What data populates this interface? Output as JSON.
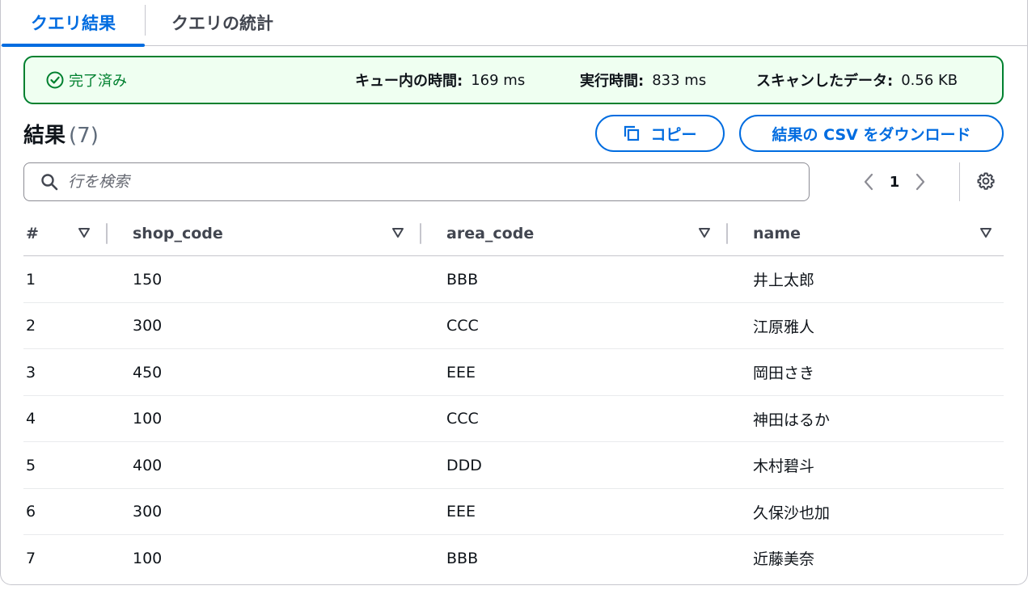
{
  "tabs": [
    {
      "label": "クエリ結果"
    },
    {
      "label": "クエリの統計"
    }
  ],
  "banner": {
    "status": "完了済み",
    "queue_time_label": "キュー内の時間:",
    "queue_time_value": "169 ms",
    "exec_time_label": "実行時間:",
    "exec_time_value": "833 ms",
    "scan_label": "スキャンしたデータ:",
    "scan_value": "0.56 KB"
  },
  "results": {
    "title": "結果",
    "count": "(7)"
  },
  "buttons": {
    "copy": "コピー",
    "download_csv": "結果の CSV をダウンロード"
  },
  "search": {
    "placeholder": "行を検索",
    "value": ""
  },
  "pagination": {
    "current_page": "1"
  },
  "table": {
    "columns": [
      "#",
      "shop_code",
      "area_code",
      "name"
    ],
    "rows": [
      [
        "1",
        "150",
        "BBB",
        "井上太郎"
      ],
      [
        "2",
        "300",
        "CCC",
        "江原雅人"
      ],
      [
        "3",
        "450",
        "EEE",
        "岡田さき"
      ],
      [
        "4",
        "100",
        "CCC",
        "神田はるか"
      ],
      [
        "5",
        "400",
        "DDD",
        "木村碧斗"
      ],
      [
        "6",
        "300",
        "EEE",
        "久保沙也加"
      ],
      [
        "7",
        "100",
        "BBB",
        "近藤美奈"
      ]
    ]
  },
  "colors": {
    "accent": "#006ce0",
    "success": "#00802f",
    "success_bg": "#effff1"
  }
}
